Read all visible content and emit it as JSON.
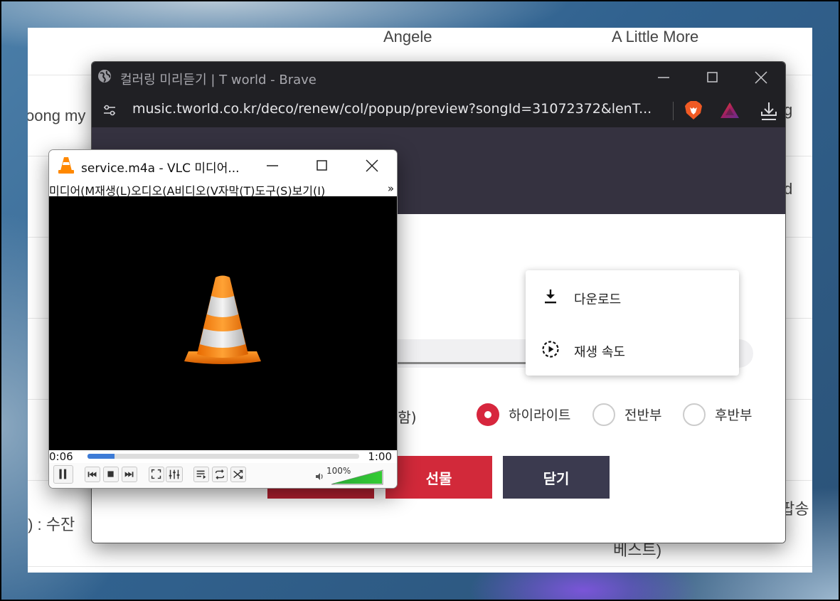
{
  "background_page": {
    "row1_artist": "Angele",
    "row1_title": "A Little More",
    "left_fragment_1": "oong my",
    "right_fragment_1": "g",
    "right_fragment_2": "d",
    "left_fragment_3": "!) : 수잔",
    "right_fragment_3": "팝송",
    "right_fragment_4": "베스트)"
  },
  "brave": {
    "title": "컬러링 미리듣기 | T world - Brave",
    "url": "music.tworld.co.kr/deco/renew/col/popup/preview?songId=31072372&lenT...",
    "icons": [
      "globe-icon",
      "tune-icon",
      "brave-lion-icon",
      "rewards-triangle-icon",
      "download-icon"
    ]
  },
  "popup": {
    "option_suffix": "포함)",
    "radios": [
      {
        "label": "하이라이트",
        "checked": true
      },
      {
        "label": "전반부",
        "checked": false
      },
      {
        "label": "후반부",
        "checked": false
      }
    ],
    "gift_button": "선물",
    "close_button": "닫기"
  },
  "context_menu": {
    "items": [
      {
        "label": "다운로드",
        "icon": "download-icon"
      },
      {
        "label": "재생 속도",
        "icon": "playback-speed-icon"
      }
    ]
  },
  "vlc": {
    "title": "service.m4a - VLC 미디어...",
    "menu": [
      "미디어(M",
      "재생(L)",
      "오디오(A",
      "비디오(V",
      "자막(T)",
      "도구(S)",
      "보기(I)"
    ],
    "menu_overflow": "»",
    "time_elapsed": "0:06",
    "time_total": "1:00",
    "seek_fraction": 0.1,
    "volume": "100%",
    "volume_fraction": 1.0
  },
  "colors": {
    "accent_red": "#d7263d",
    "dark_button": "#3b3a4f",
    "brave_chrome": "#202024",
    "vlc_orange": "#ff8800"
  }
}
